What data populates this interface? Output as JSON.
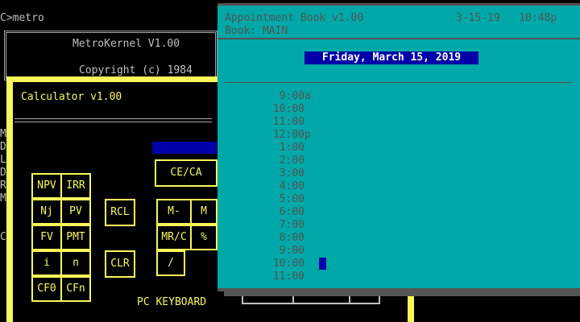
{
  "dos": {
    "prompt": "C>metro",
    "kernel_title": "MetroKernel V1.00",
    "kernel_copyright": "Copyright (c) 1984",
    "side_letters": [
      "M",
      "D",
      "L",
      "D",
      "R",
      "M",
      "C"
    ]
  },
  "calculator": {
    "title": "Calculator v1.00",
    "keyboard_label": "PC KEYBOARD",
    "keys_left": [
      [
        "NPV",
        "IRR"
      ],
      [
        "Nj",
        "PV"
      ],
      [
        "FV",
        "PMT"
      ],
      [
        "i",
        "n"
      ],
      [
        "CF0",
        "CFn"
      ]
    ],
    "key_rcl": "RCL",
    "key_clr": "CLR",
    "key_ce": "CE/CA",
    "key_mminus": "M-",
    "key_m2": "M",
    "key_mrc": "MR/C",
    "key_percent": "%",
    "key_divide": "/"
  },
  "appointment": {
    "title": "Appointment Book v1.00",
    "date_short": "3-15-19",
    "time": "10:48p",
    "book": "Book: MAIN",
    "date_long": "Friday, March 15, 2019",
    "slots": [
      {
        "time": "9:00",
        "suffix": "a"
      },
      {
        "time": "10:00",
        "suffix": ""
      },
      {
        "time": "11:00",
        "suffix": ""
      },
      {
        "time": "12:00",
        "suffix": "p"
      },
      {
        "time": "1:00",
        "suffix": ""
      },
      {
        "time": "2:00",
        "suffix": ""
      },
      {
        "time": "3:00",
        "suffix": ""
      },
      {
        "time": "4:00",
        "suffix": ""
      },
      {
        "time": "5:00",
        "suffix": ""
      },
      {
        "time": "6:00",
        "suffix": ""
      },
      {
        "time": "7:00",
        "suffix": ""
      },
      {
        "time": "8:00",
        "suffix": ""
      },
      {
        "time": "9:00",
        "suffix": ""
      },
      {
        "time": "10:00",
        "suffix": ""
      },
      {
        "time": "11:00",
        "suffix": ""
      }
    ]
  },
  "colors": {
    "calc_accent": "#f8f85a",
    "appt_background": "#00a8a8",
    "highlight": "#0000a8"
  }
}
